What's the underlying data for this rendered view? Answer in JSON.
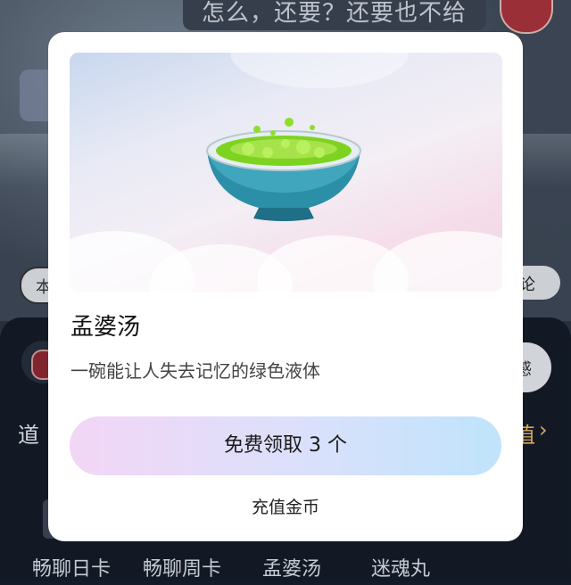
{
  "background": {
    "chat_message": "怎么，还要？还要也不给",
    "pill_left_text": "本",
    "pill_right_text": "论",
    "panel_button_text": "感",
    "panel_tab_left": "道",
    "panel_tab_right": "值",
    "gift_items": [
      {
        "label": "畅聊日卡"
      },
      {
        "label": "畅聊周卡"
      },
      {
        "label": "孟婆汤"
      },
      {
        "label": "迷魂丸"
      }
    ]
  },
  "modal": {
    "item_name": "孟婆汤",
    "item_description": "一碗能让人失去记忆的绿色液体",
    "claim_button_label": "免费领取 3 个",
    "recharge_link_label": "充值金币",
    "icon": "green-soup-bowl-icon",
    "colors": {
      "soup_green": "#7ed321",
      "bowl_blue": "#2c8fa8",
      "button_gradient_start": "#f3d6f6",
      "button_gradient_end": "#bfe4fb"
    }
  }
}
